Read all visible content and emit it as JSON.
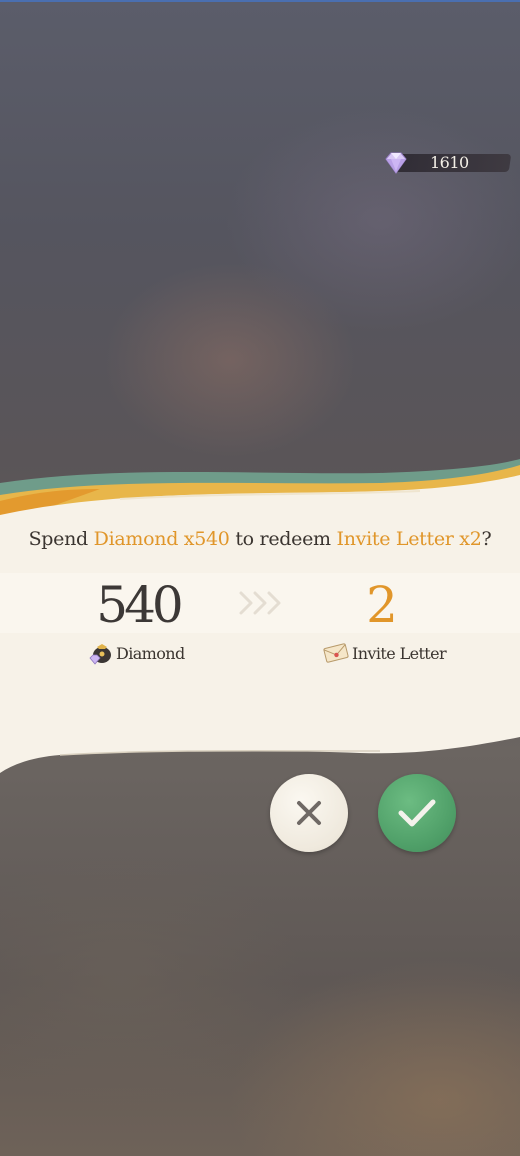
{
  "header": {
    "currency": {
      "icon": "diamond-icon",
      "amount": "1610"
    }
  },
  "dialog": {
    "prompt": {
      "spend_text": "Spend",
      "cost_item": "Diamond x540",
      "middle_text": "to redeem",
      "reward_item": "Invite Letter x2",
      "end_text": "?"
    },
    "cost": {
      "amount": "540",
      "label": "Diamond",
      "icon": "diamond-pouch-icon"
    },
    "arrow_icon": "triple-chevron-right-icon",
    "reward": {
      "amount": "2",
      "label": "Invite Letter",
      "icon": "invite-letter-icon"
    },
    "buttons": {
      "cancel_icon": "close-icon",
      "confirm_icon": "check-icon"
    }
  },
  "colors": {
    "highlight": "#e0962a",
    "text_dark": "#3b3530",
    "confirm_green": "#4f9f68",
    "panel_cream": "#f7f2e8",
    "wave_teal": "#6f9c8a",
    "wave_gold": "#e8b64a"
  }
}
